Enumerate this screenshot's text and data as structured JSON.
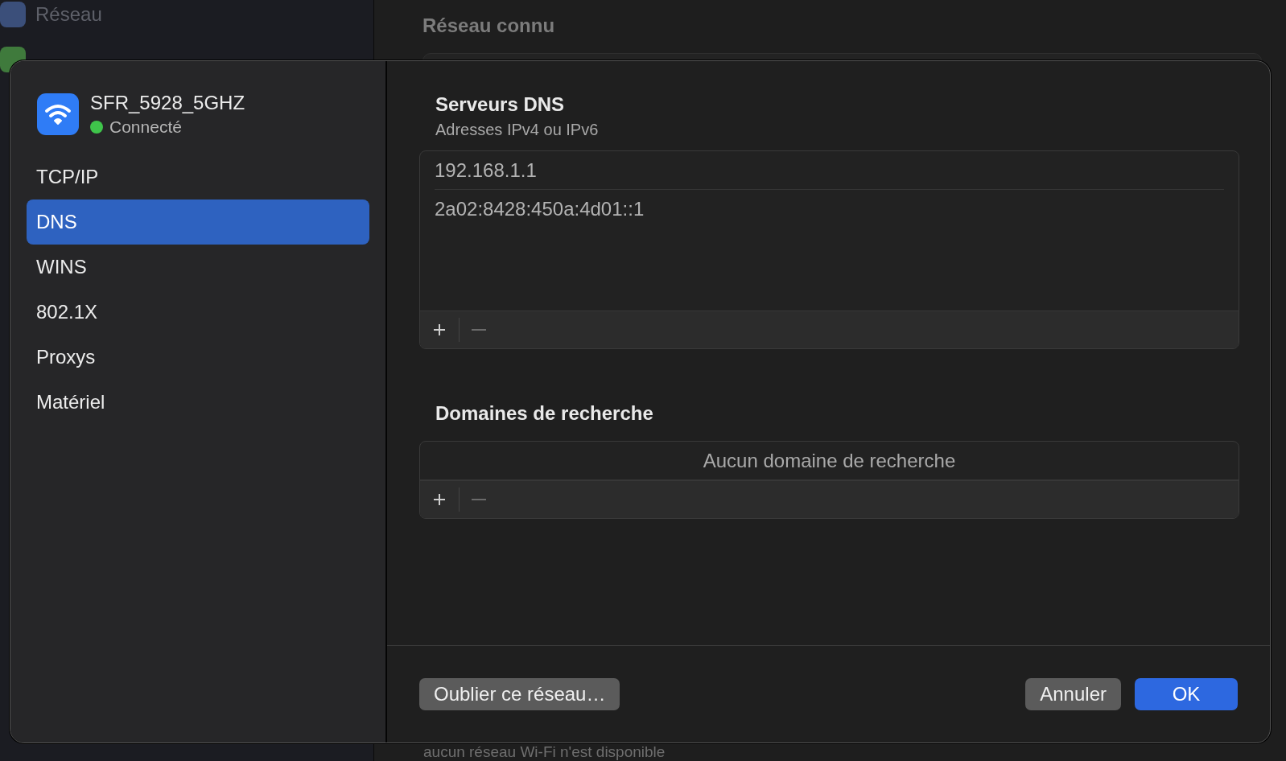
{
  "background": {
    "sidebar_items": [
      {
        "label": "Réseau"
      }
    ],
    "section_title": "Réseau connu",
    "footer_text": "aucun réseau Wi-Fi n'est disponible"
  },
  "dialog": {
    "network": {
      "name": "SFR_5928_5GHZ",
      "status": "Connecté",
      "connected": true
    },
    "tabs": [
      {
        "label": "TCP/IP",
        "selected": false
      },
      {
        "label": "DNS",
        "selected": true
      },
      {
        "label": "WINS",
        "selected": false
      },
      {
        "label": "802.1X",
        "selected": false
      },
      {
        "label": "Proxys",
        "selected": false
      },
      {
        "label": "Matériel",
        "selected": false
      }
    ],
    "dns": {
      "title": "Serveurs DNS",
      "subtitle": "Adresses IPv4 ou IPv6",
      "servers": [
        "192.168.1.1",
        "2a02:8428:450a:4d01::1"
      ],
      "remove_disabled": true
    },
    "search_domains": {
      "title": "Domaines de recherche",
      "empty_text": "Aucun domaine de recherche",
      "remove_disabled": true
    },
    "forget_button": "Oublier ce réseau…",
    "buttons": [
      {
        "label": "Annuler",
        "kind": "secondary"
      },
      {
        "label": "OK",
        "kind": "primary"
      }
    ]
  }
}
